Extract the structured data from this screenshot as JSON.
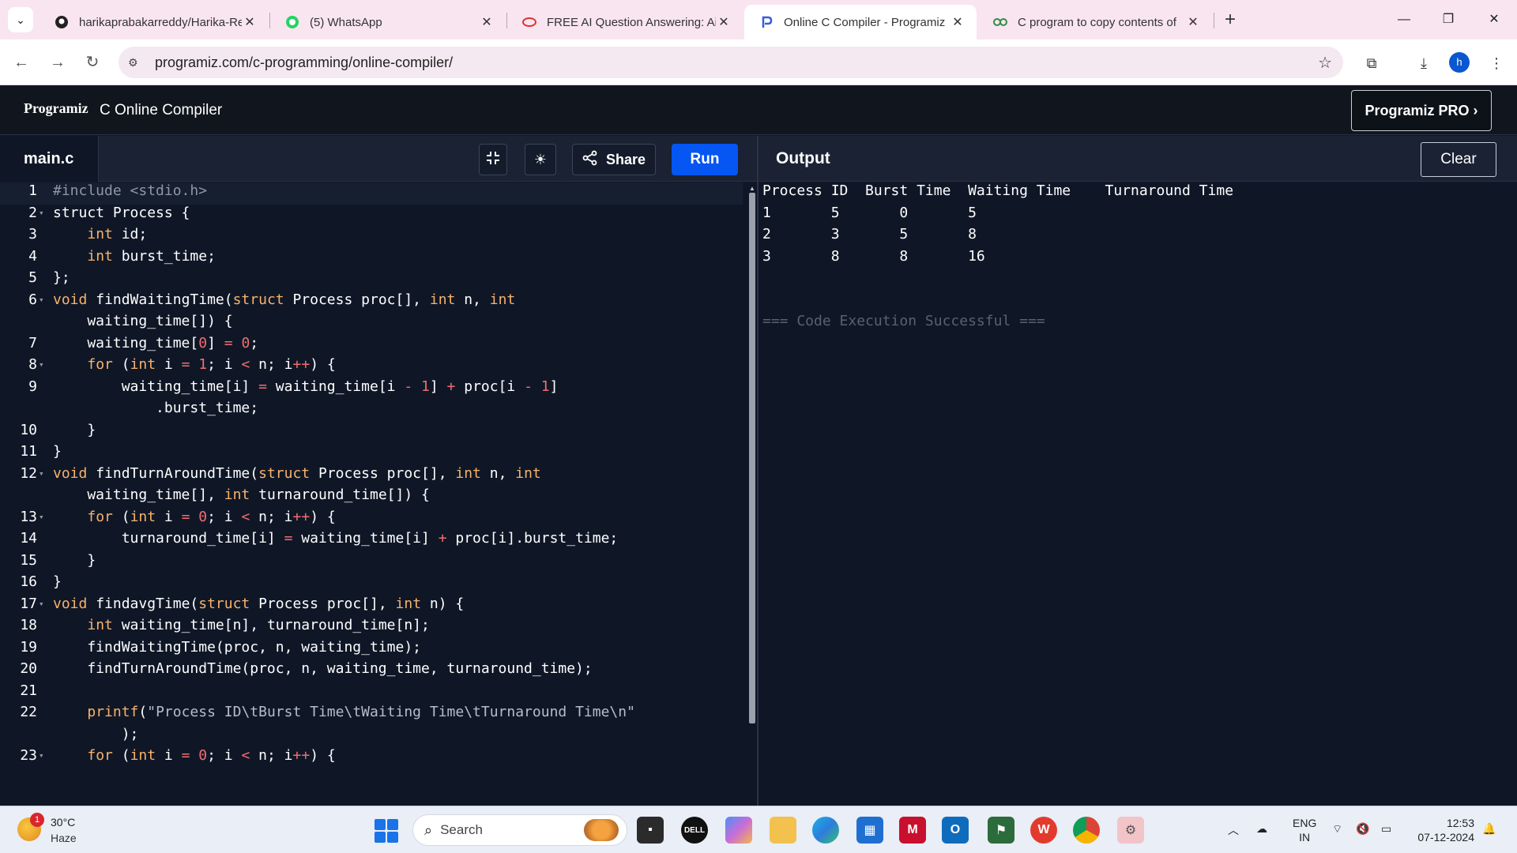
{
  "browser": {
    "tabs": [
      {
        "label": "harikaprabakarreddy/Harika-Re",
        "icon": "github-icon",
        "active": false
      },
      {
        "label": "(5) WhatsApp",
        "icon": "whatsapp-icon",
        "active": false
      },
      {
        "label": "FREE AI Question Answering: Ai",
        "icon": "ai-icon",
        "active": false
      },
      {
        "label": "Online C Compiler - Programiz",
        "icon": "programiz-icon",
        "active": true
      },
      {
        "label": "C program to copy contents of",
        "icon": "geeksforgeeks-icon",
        "active": false
      }
    ],
    "url": "programiz.com/c-programming/online-compiler/",
    "profile_initial": "h"
  },
  "site": {
    "logo": "Programiz",
    "title": "C Online Compiler",
    "pro_button": "Programiz PRO ›"
  },
  "editor": {
    "filename": "main.c",
    "share_label": "Share",
    "run_label": "Run",
    "lines": [
      {
        "n": "1",
        "fold": false,
        "html": "<span class=\"pp\">#include &lt;stdio.h&gt;</span>"
      },
      {
        "n": "2",
        "fold": true,
        "html": "struct Process {"
      },
      {
        "n": "3",
        "fold": false,
        "html": "    <span class=\"kw\">int</span> id;"
      },
      {
        "n": "4",
        "fold": false,
        "html": "    <span class=\"kw\">int</span> burst_time;"
      },
      {
        "n": "5",
        "fold": false,
        "html": "};"
      },
      {
        "n": "6",
        "fold": true,
        "html": "<span class=\"kw\">void</span> findWaitingTime(<span class=\"kw\">struct</span> Process proc[], <span class=\"kw\">int</span> n, <span class=\"kw\">int</span>"
      },
      {
        "n": "",
        "fold": false,
        "html": "    waiting_time[]) {"
      },
      {
        "n": "7",
        "fold": false,
        "html": "    waiting_time[<span class=\"num-lit\">0</span>] <span class=\"op\">=</span> <span class=\"num-lit\">0</span>;"
      },
      {
        "n": "8",
        "fold": true,
        "html": "    <span class=\"kw\">for</span> (<span class=\"kw\">int</span> i <span class=\"op\">=</span> <span class=\"num-lit\">1</span>; i <span class=\"op\">&lt;</span> n; i<span class=\"op\">++</span>) {"
      },
      {
        "n": "9",
        "fold": false,
        "html": "        waiting_time[i] <span class=\"op\">=</span> waiting_time[i <span class=\"op\">-</span> <span class=\"num-lit\">1</span>] <span class=\"op\">+</span> proc[i <span class=\"op\">-</span> <span class=\"num-lit\">1</span>]"
      },
      {
        "n": "",
        "fold": false,
        "html": "            .burst_time;"
      },
      {
        "n": "10",
        "fold": false,
        "html": "    }"
      },
      {
        "n": "11",
        "fold": false,
        "html": "}"
      },
      {
        "n": "12",
        "fold": true,
        "html": "<span class=\"kw\">void</span> findTurnAroundTime(<span class=\"kw\">struct</span> Process proc[], <span class=\"kw\">int</span> n, <span class=\"kw\">int</span>"
      },
      {
        "n": "",
        "fold": false,
        "html": "    waiting_time[], <span class=\"kw\">int</span> turnaround_time[]) {"
      },
      {
        "n": "13",
        "fold": true,
        "html": "    <span class=\"kw\">for</span> (<span class=\"kw\">int</span> i <span class=\"op\">=</span> <span class=\"num-lit\">0</span>; i <span class=\"op\">&lt;</span> n; i<span class=\"op\">++</span>) {"
      },
      {
        "n": "14",
        "fold": false,
        "html": "        turnaround_time[i] <span class=\"op\">=</span> waiting_time[i] <span class=\"op\">+</span> proc[i].burst_time;"
      },
      {
        "n": "15",
        "fold": false,
        "html": "    }"
      },
      {
        "n": "16",
        "fold": false,
        "html": "}"
      },
      {
        "n": "17",
        "fold": true,
        "html": "<span class=\"kw\">void</span> findavgTime(<span class=\"kw\">struct</span> Process proc[], <span class=\"kw\">int</span> n) {"
      },
      {
        "n": "18",
        "fold": false,
        "html": "    <span class=\"kw\">int</span> waiting_time[n], turnaround_time[n];"
      },
      {
        "n": "19",
        "fold": false,
        "html": "    findWaitingTime(proc, n, waiting_time);"
      },
      {
        "n": "20",
        "fold": false,
        "html": "    findTurnAroundTime(proc, n, waiting_time, turnaround_time);"
      },
      {
        "n": "21",
        "fold": false,
        "html": ""
      },
      {
        "n": "22",
        "fold": false,
        "html": "    <span class=\"kw\">printf</span>(<span class=\"str\">\"Process ID\\tBurst Time\\tWaiting Time\\tTurnaround Time\\n\"</span>"
      },
      {
        "n": "",
        "fold": false,
        "html": "        );"
      },
      {
        "n": "23",
        "fold": true,
        "html": "    <span class=\"kw\">for</span> (<span class=\"kw\">int</span> i <span class=\"op\">=</span> <span class=\"num-lit\">0</span>; i <span class=\"op\">&lt;</span> n; i<span class=\"op\">++</span>) {"
      }
    ]
  },
  "output": {
    "label": "Output",
    "clear_label": "Clear",
    "lines": [
      "Process ID  Burst Time  Waiting Time    Turnaround Time",
      "1       5       0       5",
      "2       3       5       8",
      "3       8       8       16",
      "",
      "",
      "=== Code Execution Successful ==="
    ]
  },
  "taskbar": {
    "temperature": "30°C",
    "condition": "Haze",
    "weather_badge": "1",
    "search_label": "Search",
    "lang_top": "ENG",
    "lang_bottom": "IN",
    "time": "12:53",
    "date": "07-12-2024"
  }
}
